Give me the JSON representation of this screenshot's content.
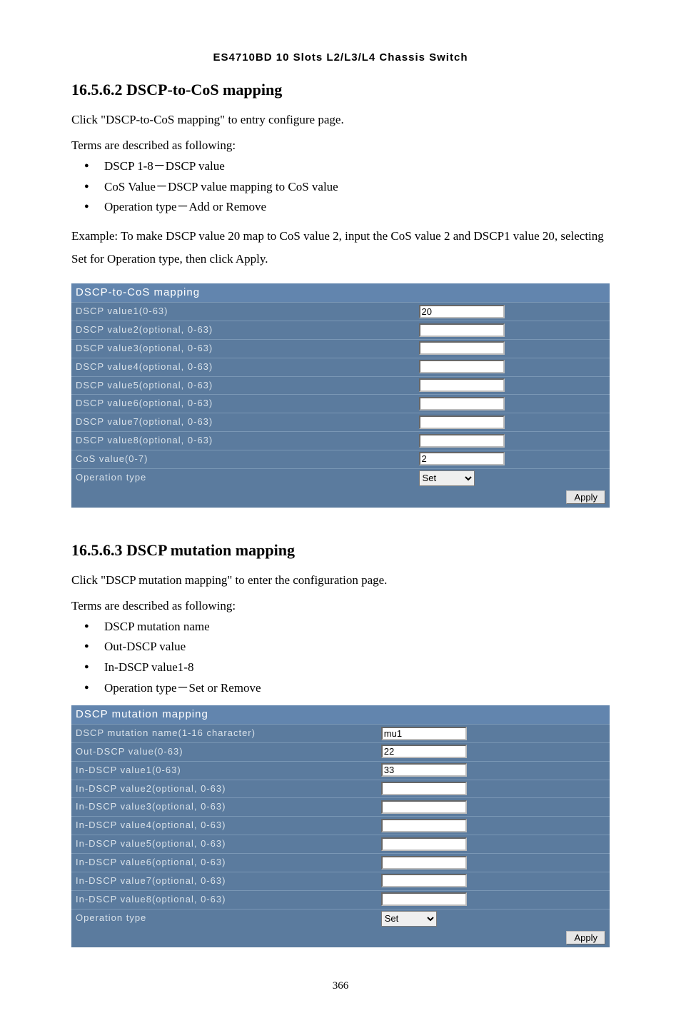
{
  "doc_header": "ES4710BD 10 Slots L2/L3/L4 Chassis Switch",
  "page_number": "366",
  "section1": {
    "heading": "16.5.6.2 DSCP-to-CoS mapping",
    "intro": "Click \"DSCP-to-CoS mapping\" to entry configure page.",
    "terms_title": "Terms are described as following:",
    "terms": [
      "DSCP 1-8－DSCP value",
      "CoS Value－DSCP value mapping to CoS value",
      "Operation type－Add or Remove"
    ],
    "example": "Example: To make DSCP value 20 map to CoS value 2, input the CoS value 2 and DSCP1 value 20, selecting Set for Operation type, then click Apply.",
    "table": {
      "title": "DSCP-to-CoS mapping",
      "rows": [
        {
          "label": "DSCP value1(0-63)",
          "value": "20"
        },
        {
          "label": "DSCP value2(optional, 0-63)",
          "value": ""
        },
        {
          "label": "DSCP value3(optional, 0-63)",
          "value": ""
        },
        {
          "label": "DSCP value4(optional, 0-63)",
          "value": ""
        },
        {
          "label": "DSCP value5(optional, 0-63)",
          "value": ""
        },
        {
          "label": "DSCP value6(optional, 0-63)",
          "value": ""
        },
        {
          "label": "DSCP value7(optional, 0-63)",
          "value": ""
        },
        {
          "label": "DSCP value8(optional, 0-63)",
          "value": ""
        },
        {
          "label": "CoS value(0-7)",
          "value": "2"
        }
      ],
      "op_label": "Operation type",
      "op_value": "Set",
      "apply": "Apply"
    }
  },
  "section2": {
    "heading": "16.5.6.3 DSCP mutation mapping",
    "intro": "Click \"DSCP mutation mapping\" to enter the configuration page.",
    "terms_title": "Terms are described as following:",
    "terms": [
      "DSCP mutation name",
      "Out-DSCP value",
      "In-DSCP value1-8",
      "Operation type－Set or Remove"
    ],
    "table": {
      "title": "DSCP mutation mapping",
      "rows": [
        {
          "label": "DSCP mutation name(1-16 character)",
          "value": "mu1"
        },
        {
          "label": "Out-DSCP value(0-63)",
          "value": "22"
        },
        {
          "label": "In-DSCP value1(0-63)",
          "value": "33"
        },
        {
          "label": "In-DSCP value2(optional, 0-63)",
          "value": ""
        },
        {
          "label": "In-DSCP value3(optional, 0-63)",
          "value": ""
        },
        {
          "label": "In-DSCP value4(optional, 0-63)",
          "value": ""
        },
        {
          "label": "In-DSCP value5(optional, 0-63)",
          "value": ""
        },
        {
          "label": "In-DSCP value6(optional, 0-63)",
          "value": ""
        },
        {
          "label": "In-DSCP value7(optional, 0-63)",
          "value": ""
        },
        {
          "label": "In-DSCP value8(optional, 0-63)",
          "value": ""
        }
      ],
      "op_label": "Operation type",
      "op_value": "Set",
      "apply": "Apply"
    }
  }
}
